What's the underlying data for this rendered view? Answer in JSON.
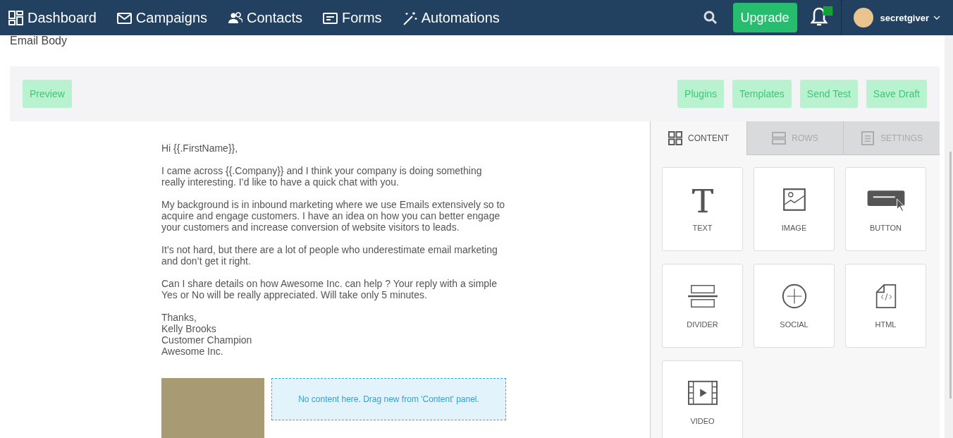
{
  "nav": {
    "items": [
      {
        "label": "Dashboard"
      },
      {
        "label": "Campaigns"
      },
      {
        "label": "Contacts"
      },
      {
        "label": "Forms"
      },
      {
        "label": "Automations"
      }
    ],
    "upgrade": "Upgrade",
    "notification_checked": true,
    "user": "secretgiver"
  },
  "section_title": "Email Body",
  "toolbar": {
    "left": [
      "Preview"
    ],
    "right": [
      "Plugins",
      "Templates",
      "Send Test",
      "Save Draft"
    ]
  },
  "email": {
    "paragraphs": [
      "Hi {{.FirstName}},",
      "I came across {{.Company}} and I think your company is doing something really interesting. I’d like to have a quick chat with you.",
      "My background is in inbound marketing where we use Emails extensively so to acquire and engage customers. I have an idea on how you can better engage your customers and increase conversion of website visitors to leads.",
      "It’s not hard, but there are a lot of people who underestimate email marketing and don’t get it right.",
      "Can I share details on how Awesome Inc. can help ? Your reply with a simple Yes or No will be really appreciated. Will take only 5 minutes."
    ],
    "signature": [
      "Thanks,",
      "Kelly Brooks",
      "Customer Champion",
      "Awesome Inc."
    ],
    "drop_zone": "No content here. Drag new from 'Content' panel."
  },
  "panel": {
    "tabs": [
      {
        "label": "CONTENT",
        "selected": true
      },
      {
        "label": "ROWS",
        "selected": false
      },
      {
        "label": "SETTINGS",
        "selected": false
      }
    ],
    "blocks": [
      {
        "label": "TEXT"
      },
      {
        "label": "IMAGE"
      },
      {
        "label": "BUTTON"
      },
      {
        "label": "DIVIDER"
      },
      {
        "label": "SOCIAL"
      },
      {
        "label": "HTML"
      },
      {
        "label": "VIDEO"
      }
    ]
  }
}
